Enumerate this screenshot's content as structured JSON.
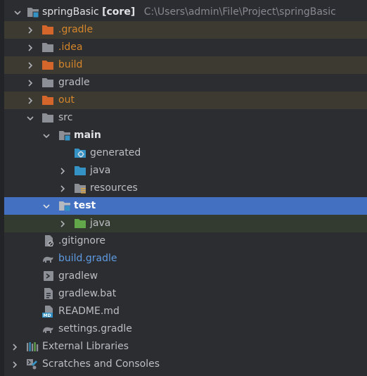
{
  "project": {
    "name": "springBasic",
    "module": "[core]",
    "path": "C:\\Users\\admin\\File\\Project\\springBasic"
  },
  "tree": {
    "gradle_dir": ".gradle",
    "idea_dir": ".idea",
    "build_dir": "build",
    "gradle": "gradle",
    "out_dir": "out",
    "src": "src",
    "main": "main",
    "generated": "generated",
    "main_java": "java",
    "resources": "resources",
    "test": "test",
    "test_java": "java",
    "gitignore": ".gitignore",
    "build_gradle": "build.gradle",
    "gradlew": "gradlew",
    "gradlew_bat": "gradlew.bat",
    "readme": "README.md",
    "settings_gradle": "settings.gradle",
    "external_libraries": "External Libraries",
    "scratches": "Scratches and Consoles"
  },
  "icons": {
    "folder": "folder-icon",
    "module": "module-folder-icon",
    "source_root": "source-root-icon",
    "test_root": "test-root-icon",
    "resources_root": "resources-root-icon",
    "generated": "generated-sources-icon",
    "gradle": "gradle-icon",
    "terminal": "terminal-icon",
    "file": "file-icon",
    "markdown": "markdown-icon",
    "libraries": "libraries-icon",
    "scratches": "scratches-icon"
  },
  "colors": {
    "excluded_text": "#d5862b",
    "excluded_bg": "#3d3a32",
    "selection_bg": "#4370c0",
    "test_bg": "#333a2f",
    "modified_text": "#5f9be3",
    "folder_gray": "#8c8f96",
    "folder_orange": "#d5662b",
    "source_blue": "#3592c4",
    "test_green": "#62a84a"
  }
}
